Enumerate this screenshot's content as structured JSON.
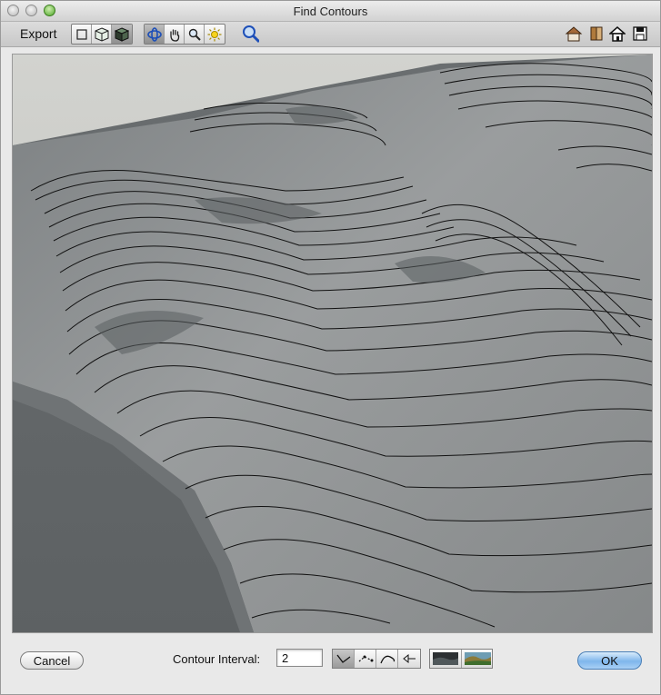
{
  "window": {
    "title": "Find Contours"
  },
  "toolbar": {
    "export_label": "Export",
    "view_modes": [
      "wireframe-icon",
      "solid-cube-icon",
      "shaded-cube-icon"
    ],
    "selected_view_mode": 2,
    "tools": [
      "rotate-icon",
      "hand-pan-icon",
      "zoom-icon",
      "light-icon"
    ],
    "selected_tool": 0,
    "right_icons": [
      "house-view-icon",
      "book-icon",
      "home-icon",
      "save-disk-icon"
    ]
  },
  "bottom": {
    "cancel_label": "Cancel",
    "contour_interval_label": "Contour Interval:",
    "contour_interval_value": "2",
    "contour_styles": [
      "flat-lines-icon",
      "dotted-lines-icon",
      "curved-lines-icon",
      "arrow-lines-icon"
    ],
    "selected_contour_style": 0,
    "terrain_swatches": [
      "dark-terrain-swatch",
      "colored-terrain-swatch"
    ],
    "ok_label": "OK"
  },
  "colors": {
    "terrain": "#8e9192",
    "terrain_dark": "#5a5e60",
    "background": "#c6c7c3",
    "contour": "#111111",
    "ok_button": "#7fb6ec"
  }
}
